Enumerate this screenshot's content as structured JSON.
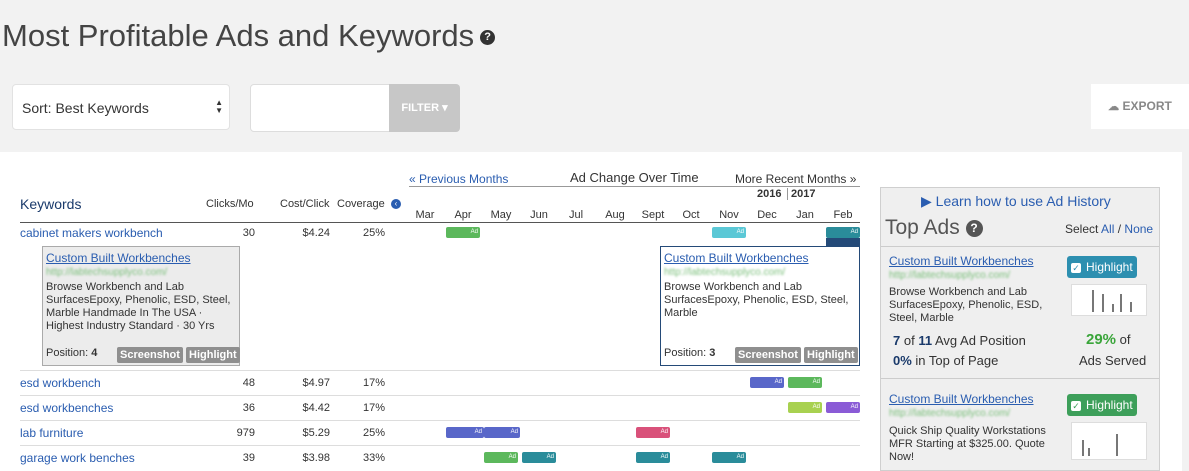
{
  "header": {
    "title": "Most Profitable Ads and Keywords",
    "help_glyph": "?"
  },
  "toolbar": {
    "sort_label": "Sort: Best Keywords",
    "filter_placeholder": "",
    "filter_label": "FILTER ▾",
    "export_label": "EXPORT",
    "export_icon": "cloud-download-icon"
  },
  "timeline": {
    "prev": "« Previous Months",
    "title": "Ad Change Over Time",
    "next": "More Recent Months »",
    "year1": "2016",
    "year2": "2017",
    "months": [
      "Mar",
      "Apr",
      "May",
      "Jun",
      "Jul",
      "Aug",
      "Sept",
      "Oct",
      "Nov",
      "Dec",
      "Jan",
      "Feb"
    ]
  },
  "table": {
    "headers": {
      "keywords": "Keywords",
      "clicks": "Clicks/Mo",
      "cost": "Cost/Click",
      "coverage": "Coverage"
    },
    "rows": [
      {
        "keyword": "cabinet makers workbench",
        "clicks": "30",
        "cost": "$4.24",
        "coverage": "25%"
      },
      {
        "keyword": "esd workbench",
        "clicks": "48",
        "cost": "$4.97",
        "coverage": "17%"
      },
      {
        "keyword": "esd workbenches",
        "clicks": "36",
        "cost": "$4.42",
        "coverage": "17%"
      },
      {
        "keyword": "lab furniture",
        "clicks": "979",
        "cost": "$5.29",
        "coverage": "25%"
      },
      {
        "keyword": "garage work benches",
        "clicks": "39",
        "cost": "$3.98",
        "coverage": "33%"
      }
    ],
    "bar_label": "Ad",
    "colors": {
      "green": "#5cb85c",
      "teal": "#2a8c9a",
      "cyan": "#5bc8d6",
      "blue": "#5967c9",
      "lime": "#a8d150",
      "purple": "#8a5bd6",
      "pink": "#d9517a"
    }
  },
  "ads": {
    "a1": {
      "headline": "Custom Built Workbenches",
      "url": "http://labtechsupplyco.com/",
      "desc": "Browse Workbench and Lab SurfacesEpoxy, Phenolic, ESD, Steel, Marble Handmade In The USA · Highest Industry Standard · 30 Yrs",
      "pos_label": "Position:",
      "pos": "4",
      "screenshot": "Screenshot",
      "highlight": "Highlight"
    },
    "a2": {
      "headline": "Custom Built Workbenches",
      "url": "http://labtechsupplyco.com/",
      "desc": "Browse Workbench and Lab SurfacesEpoxy, Phenolic, ESD, Steel, Marble",
      "pos_label": "Position:",
      "pos": "3",
      "screenshot": "Screenshot",
      "highlight": "Highlight"
    }
  },
  "sidebar": {
    "learn": "Learn how to use Ad History",
    "title": "Top Ads",
    "select": "Select",
    "all": "All",
    "sep": "/",
    "none": "None",
    "cards": [
      {
        "headline": "Custom Built Workbenches",
        "url": "http://labtechsupplyco.com/",
        "desc": "Browse Workbench and Lab SurfacesEpoxy, Phenolic, ESD, Steel, Marble",
        "highlight": "Highlight",
        "pos_of": "7",
        "of": "of",
        "pos_total": "11",
        "pos_text": "Avg Ad Position",
        "top": "0%",
        "top_text": "in Top of Page",
        "served": "29%",
        "served_of": "of",
        "served_text": "Ads Served"
      },
      {
        "headline": "Custom Built Workbenches",
        "url": "http://labtechsupplyco.com/",
        "desc": "Quick Ship Quality Workstations MFR Starting at $325.00. Quote Now!",
        "highlight": "Highlight"
      }
    ]
  }
}
